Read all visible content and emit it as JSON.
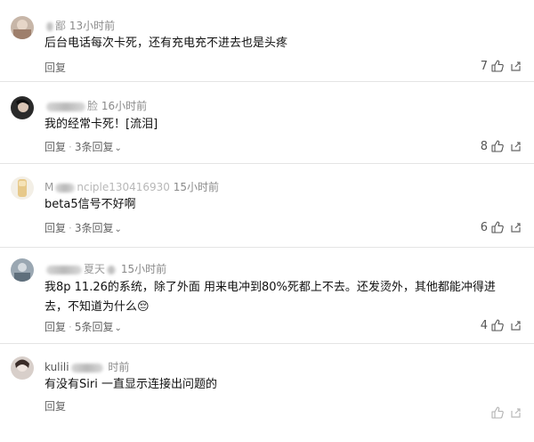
{
  "comments": [
    {
      "name_visible": "鄙",
      "time": "13小时前",
      "text": "后台电话每次卡死，还有充电充不进去也是头疼",
      "reply": "回复",
      "replies": "",
      "likes": "7"
    },
    {
      "name_visible": "脸",
      "time": "16小时前",
      "text": "我的经常卡死！[流泪]",
      "reply": "回复",
      "replies": "3条回复",
      "likes": "8"
    },
    {
      "name_visible": "M",
      "name_visible_2": "nciple130416930",
      "time": "15小时前",
      "text": "beta5信号不好啊",
      "reply": "回复",
      "replies": "3条回复",
      "likes": "6"
    },
    {
      "name_visible": "夏天",
      "time": "15小时前",
      "text": "我8p 11.26的系统，除了外面 用来电冲到80%死都上不去。还发烫外，其他都能冲得进去，不知道为什么😔",
      "reply": "回复",
      "replies": "5条回复",
      "likes": "4"
    },
    {
      "name_visible": "kulili",
      "time": "时前",
      "text": "有没有Siri 一直显示连接出问题的",
      "reply": "回复",
      "replies": "",
      "likes": ""
    }
  ],
  "icons": {
    "like": "thumbs-up-icon",
    "share": "share-icon",
    "chevron": "chevron-down-icon"
  },
  "colors": {
    "text": "#111111",
    "meta": "#8a8a8a",
    "divider": "#e4e4e4"
  }
}
